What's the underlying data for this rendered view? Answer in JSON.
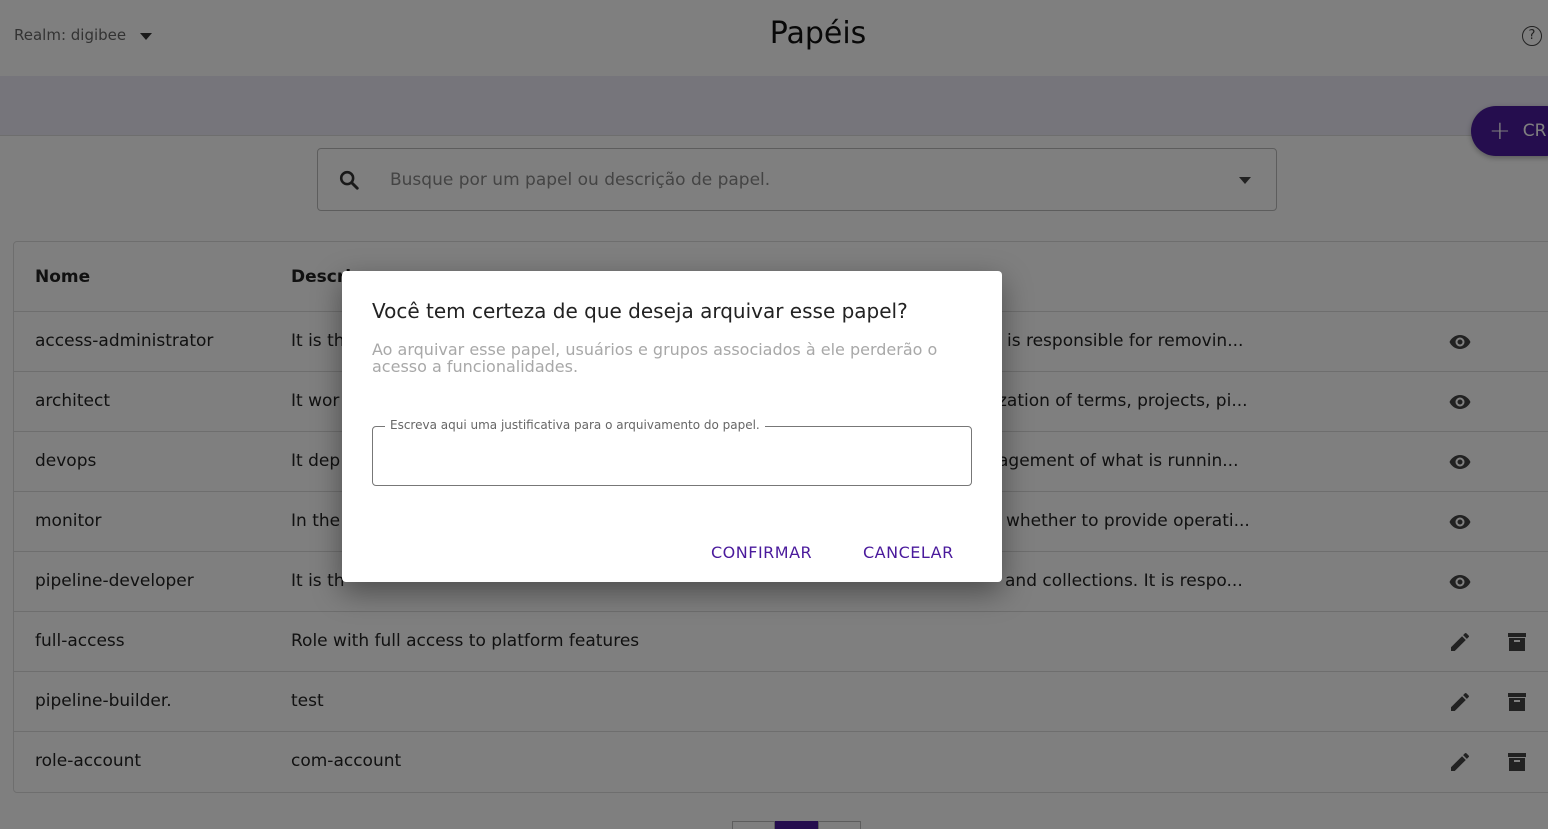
{
  "header": {
    "realm": "Realm: digibee",
    "title": "Papéis",
    "help": "?"
  },
  "toolbar": {
    "create_label": "CR"
  },
  "search": {
    "placeholder": "Busque por um papel ou descrição de papel."
  },
  "table": {
    "headers": {
      "name": "Nome",
      "description": "Descri"
    },
    "rows": [
      {
        "name": "access-administrator",
        "description": "It is th",
        "description_tail": "is responsible for removin...",
        "action": "view"
      },
      {
        "name": "architect",
        "description": "It wor",
        "description_tail": "zation of terms, projects, pi...",
        "action": "view"
      },
      {
        "name": "devops",
        "description": "It dep",
        "description_tail": "agement of what is runnin...",
        "action": "view"
      },
      {
        "name": "monitor",
        "description": "In the",
        "description_tail": "whether to provide operati...",
        "action": "view"
      },
      {
        "name": "pipeline-developer",
        "description": "It is th",
        "description_tail": "and collections. It is respo...",
        "action": "view"
      },
      {
        "name": "full-access",
        "description": "Role with full access to platform features",
        "description_tail": "",
        "action": "edit"
      },
      {
        "name": "pipeline-builder.",
        "description": "test",
        "description_tail": "",
        "action": "edit"
      },
      {
        "name": "role-account",
        "description": "com-account",
        "description_tail": "",
        "action": "edit"
      }
    ]
  },
  "dialog": {
    "title": "Você tem certeza de que deseja arquivar esse papel?",
    "message": "Ao arquivar esse papel, usuários e grupos associados à ele perderão o acesso a funcionalidades.",
    "field_label": "Escreva aqui uma justificativa para o arquivamento do papel.",
    "field_value": "",
    "confirm_label": "CONFIRMAR",
    "cancel_label": "CANCELAR"
  },
  "colors": {
    "accent": "#4a1a9c",
    "overlay": "rgba(0,0,0,0.5)"
  },
  "icons": {
    "view": "eye-icon",
    "edit": "pencil-icon",
    "archive": "archive-icon",
    "search": "search-icon"
  }
}
